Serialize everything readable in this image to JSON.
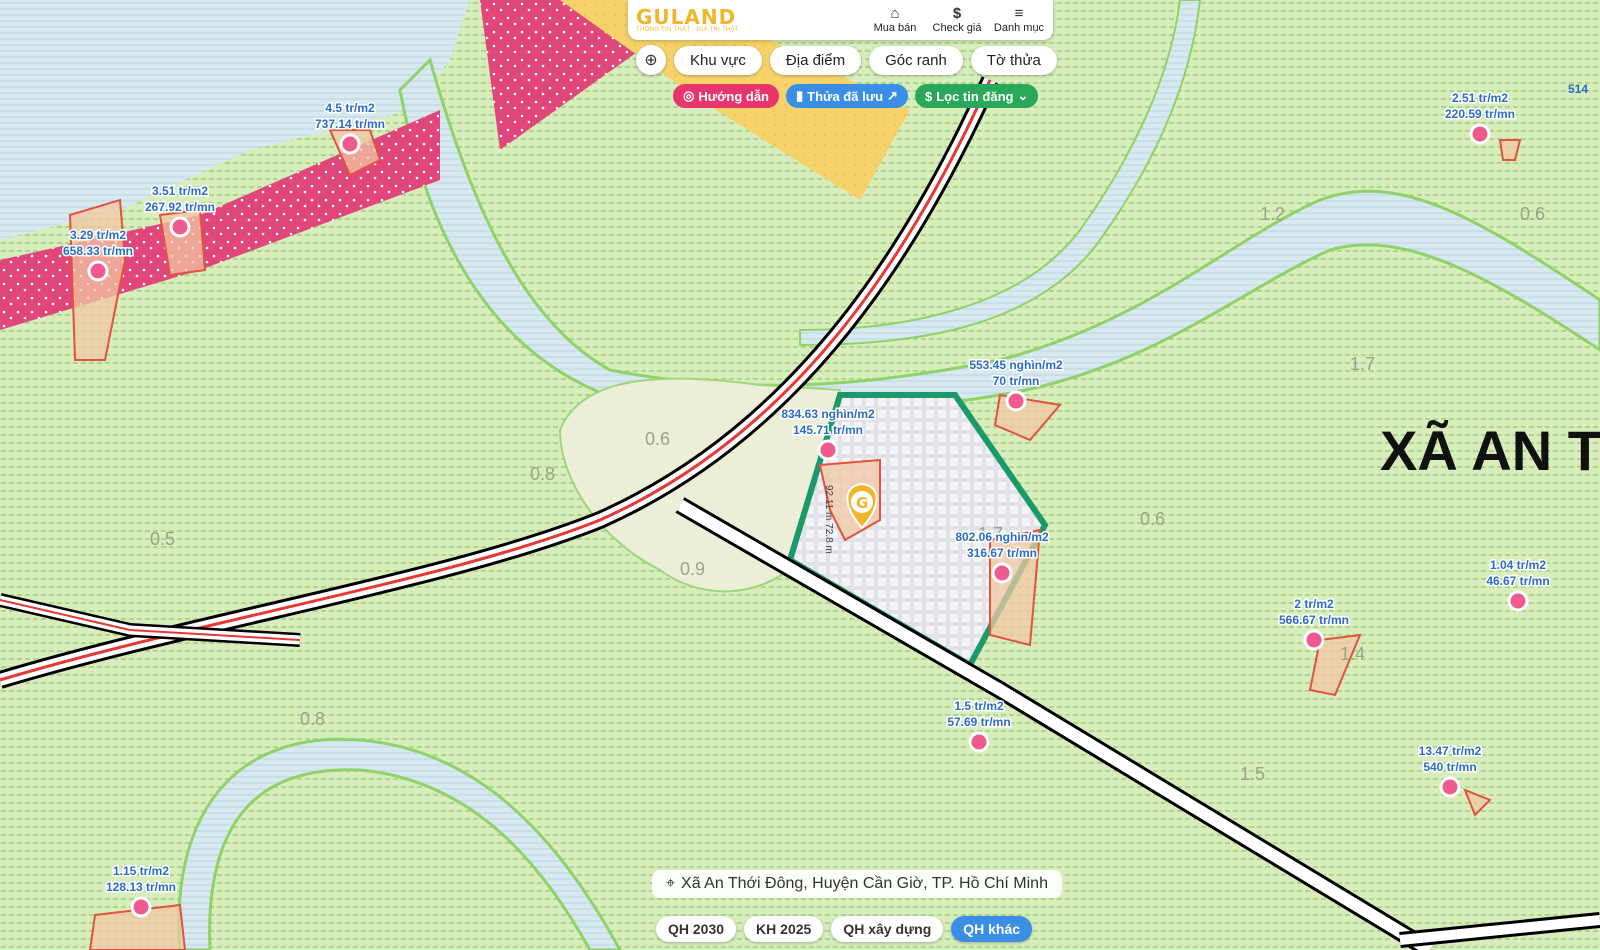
{
  "app": {
    "logo": "GULAND",
    "tagline": "THÔNG TIN THẬT - GIÁ TRỊ THẬT",
    "brand_color": "#f0b62b"
  },
  "top_actions": [
    {
      "label": "Mua bán",
      "icon": "house-icon"
    },
    {
      "label": "Check giá",
      "icon": "dollar-icon"
    },
    {
      "label": "Danh mục",
      "icon": "menu-icon"
    }
  ],
  "search_tabs": [
    "Khu vực",
    "Địa điểm",
    "Góc ranh",
    "Tờ thửa"
  ],
  "pills": {
    "guide": "Hướng dẫn",
    "saved": "Thửa đã lưu",
    "filter": "Lọc tin đăng"
  },
  "location": "Xã An Thới Đông, Huyện Cần Giờ, TP. Hồ Chí Minh",
  "plan_tabs": [
    {
      "label": "QH 2030",
      "active": false
    },
    {
      "label": "KH 2025",
      "active": false
    },
    {
      "label": "QH xây dựng",
      "active": false
    },
    {
      "label": "QH khác",
      "active": true
    }
  ],
  "map": {
    "region_label": "XÃ AN T",
    "selected_dims": "92.11 m 72.8 m",
    "area_labels": [
      "0.6",
      "0.8",
      "0.9",
      "1.7",
      "0.5",
      "0.8",
      "0.6",
      "1.2",
      "1.7",
      "1.4",
      "0.6",
      "1.5"
    ],
    "price_markers": [
      {
        "price": "4.5 tr/m2",
        "value": "737.14 tr/mn"
      },
      {
        "price": "3.51 tr/m2",
        "value": "267.92 tr/mn"
      },
      {
        "price": "3.29 tr/m2",
        "value": "658.33 tr/mn"
      },
      {
        "price": "2.51 tr/m2",
        "value": "220.59 tr/mn"
      },
      {
        "price": "553.45 nghìn/m2",
        "value": "70 tr/mn"
      },
      {
        "price": "834.63 nghìn/m2",
        "value": "145.71 tr/mn"
      },
      {
        "price": "802.06 nghìn/m2",
        "value": "316.67 tr/mn"
      },
      {
        "price": "1.04 tr/m2",
        "value": "46.67 tr/mn"
      },
      {
        "price": "2 tr/m2",
        "value": "566.67 tr/mn"
      },
      {
        "price": "1.5 tr/m2",
        "value": "57.69 tr/mn"
      },
      {
        "price": "13.47 tr/m2",
        "value": "540 tr/mn"
      },
      {
        "price": "1.15 tr/m2",
        "value": "128.13 tr/mn"
      }
    ],
    "edge_label": "514"
  },
  "colors": {
    "land": "#d6ebb8",
    "river": "#cfe4ee",
    "residential": "#e04a7a",
    "commercial": "#f6d36a",
    "marker": "#ef5b8c",
    "road_red": "#e53935",
    "boundary": "#1a9a6a"
  }
}
